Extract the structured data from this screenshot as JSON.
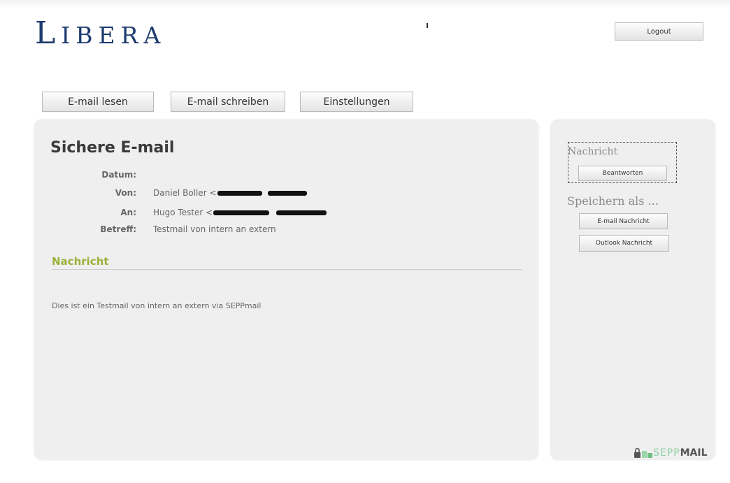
{
  "header": {
    "logo_initial": "L",
    "logo_rest": "IBERA",
    "logout_label": "Logout"
  },
  "nav": {
    "items": [
      {
        "label": "E-mail lesen"
      },
      {
        "label": "E-mail schreiben"
      },
      {
        "label": "Einstellungen"
      }
    ]
  },
  "message": {
    "title": "Sichere E-mail",
    "fields": {
      "datum_label": "Datum:",
      "datum_value": "",
      "von_label": "Von:",
      "von_value": "Daniel Boller <",
      "an_label": "An:",
      "an_value": "Hugo Tester <",
      "betreff_label": "Betreff:",
      "betreff_value": "Testmail von intern an extern"
    },
    "section_title": "Nachricht",
    "body": "Dies ist ein Testmail von intern an extern via SEPPmail"
  },
  "sidebar": {
    "nachricht_heading": "Nachricht",
    "reply_button": "Beantworten",
    "save_heading": "Speichern als ...",
    "save_email_button": "E-mail Nachricht",
    "save_outlook_button": "Outlook Nachricht"
  },
  "footer": {
    "brand_a": "SEPP",
    "brand_b": "MAIL"
  }
}
